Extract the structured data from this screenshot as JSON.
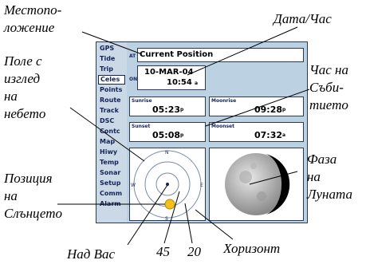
{
  "callouts": {
    "location": [
      "Местопо-",
      "ложение"
    ],
    "date_time": "Дата/Час",
    "sky_view": [
      "Поле с",
      "изглед",
      "на",
      "небето"
    ],
    "event_time": [
      "Час на",
      "Съби-",
      "тието"
    ],
    "moon_phase": [
      "Фаза",
      "на",
      "Луната"
    ],
    "sun_position": [
      "Позиция",
      "на",
      "Слънцето"
    ],
    "overhead": "Над Вас",
    "ring_45": "45",
    "ring_20": "20",
    "horizon": "Хоризонт"
  },
  "menu": {
    "items": [
      "GPS",
      "Tide",
      "Trip",
      "Celes",
      "Points",
      "Route",
      "Track",
      "DSC",
      "Contc",
      "Map",
      "Hiwy",
      "Temp",
      "Sonar",
      "Setup",
      "Comm",
      "Alarm"
    ],
    "active_index": 3
  },
  "panel": {
    "position_prefix": "AT",
    "position_label": "Current Position",
    "date_prefix": "ON",
    "date": "10-MAR-04",
    "time": "10:54",
    "time_suffix": "a",
    "sunrise_label": "Sunrise",
    "sunrise": "05:23",
    "sunrise_suffix": "p",
    "moonrise_label": "Moonrise",
    "moonrise": "09:28",
    "moonrise_suffix": "p",
    "sunset_label": "Sunset",
    "sunset": "05:08",
    "sunset_suffix": "p",
    "moonset_label": "Moonset",
    "moonset": "07:32",
    "moonset_suffix": "a",
    "compass": {
      "n": "N",
      "s": "S",
      "e": "E",
      "w": "W"
    }
  },
  "colors": {
    "device_bg": "#bcd2e3",
    "accent": "#14235a",
    "sun": "#f2c21a",
    "moon_shadow": "#000000"
  }
}
